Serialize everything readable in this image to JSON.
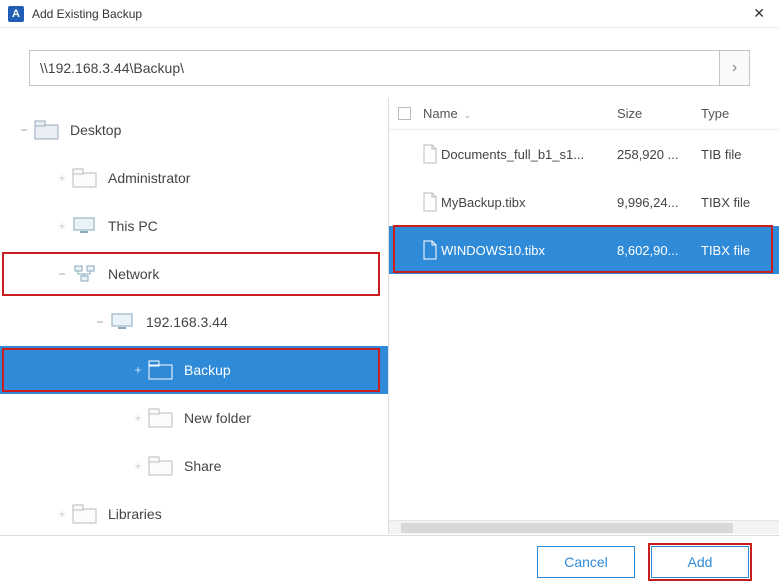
{
  "window": {
    "title": "Add Existing Backup",
    "app_icon_letter": "A"
  },
  "path": "\\\\192.168.3.44\\Backup\\",
  "tree": {
    "desktop": "Desktop",
    "administrator": "Administrator",
    "this_pc": "This PC",
    "network": "Network",
    "host": "192.168.3.44",
    "backup": "Backup",
    "new_folder": "New folder",
    "share": "Share",
    "libraries": "Libraries"
  },
  "columns": {
    "name": "Name",
    "size": "Size",
    "type": "Type"
  },
  "files": [
    {
      "name": "Documents_full_b1_s1...",
      "size": "258,920 ...",
      "type": "TIB file",
      "selected": false
    },
    {
      "name": "MyBackup.tibx",
      "size": "9,996,24...",
      "type": "TIBX file",
      "selected": false
    },
    {
      "name": "WINDOWS10.tibx",
      "size": "8,602,90...",
      "type": "TIBX file",
      "selected": true
    }
  ],
  "buttons": {
    "cancel": "Cancel",
    "add": "Add"
  }
}
